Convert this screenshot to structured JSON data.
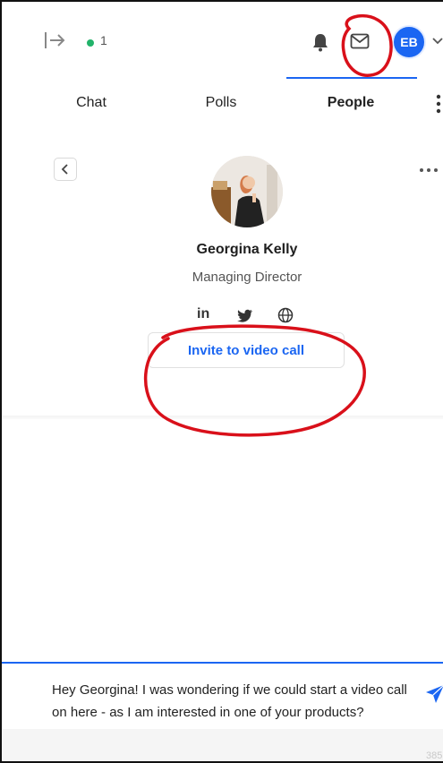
{
  "header": {
    "online_count": "1",
    "user_initials": "EB",
    "icons": [
      "collapse-panel-icon",
      "bell-icon",
      "mail-icon",
      "chevron-down-icon"
    ]
  },
  "tabs": [
    {
      "label": "Chat",
      "active": false
    },
    {
      "label": "Polls",
      "active": false
    },
    {
      "label": "People",
      "active": true
    }
  ],
  "profile": {
    "name": "Georgina Kelly",
    "role": "Managing Director",
    "social": {
      "linkedin_label": "in"
    },
    "invite_label": "Invite to video call"
  },
  "composer": {
    "message": "Hey Georgina! I was wondering if we could start a video call on here - as I am interested in one of your products?",
    "char_count": "385"
  },
  "colors": {
    "accent": "#1b66f2",
    "online": "#22b36a",
    "annotation": "#d9101a"
  }
}
